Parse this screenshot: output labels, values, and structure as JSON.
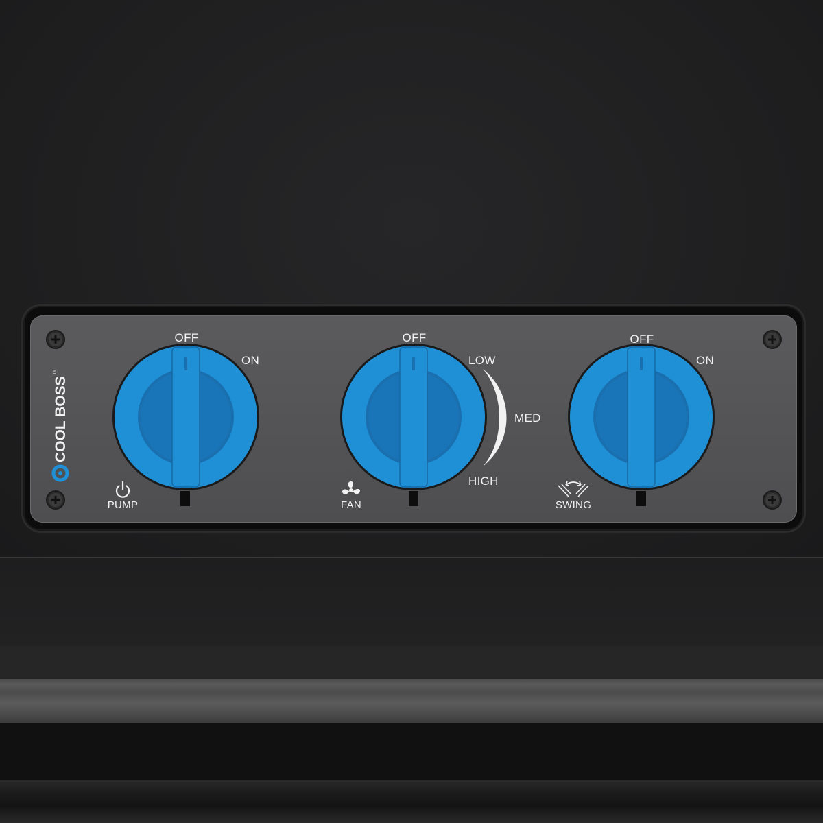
{
  "brand": {
    "name": "COOL BOSS",
    "mark": "TM"
  },
  "knobs": [
    {
      "id": "pump",
      "function_label": "PUMP",
      "icon": "power-icon",
      "settings": {
        "off": "OFF",
        "on": "ON"
      },
      "current_setting": "OFF"
    },
    {
      "id": "fan",
      "function_label": "FAN",
      "icon": "fan-icon",
      "settings": {
        "off": "OFF",
        "low": "LOW",
        "med": "MED",
        "high": "HIGH"
      },
      "current_setting": "OFF"
    },
    {
      "id": "swing",
      "function_label": "SWING",
      "icon": "swing-icon",
      "settings": {
        "off": "OFF",
        "on": "ON"
      },
      "current_setting": "OFF"
    }
  ],
  "colors": {
    "knob_blue": "#1f8fd6",
    "knob_blue_dark": "#1577b8",
    "panel_gray": "#555557",
    "label_white": "#f2f2f2",
    "body_black": "#1f1f20"
  }
}
